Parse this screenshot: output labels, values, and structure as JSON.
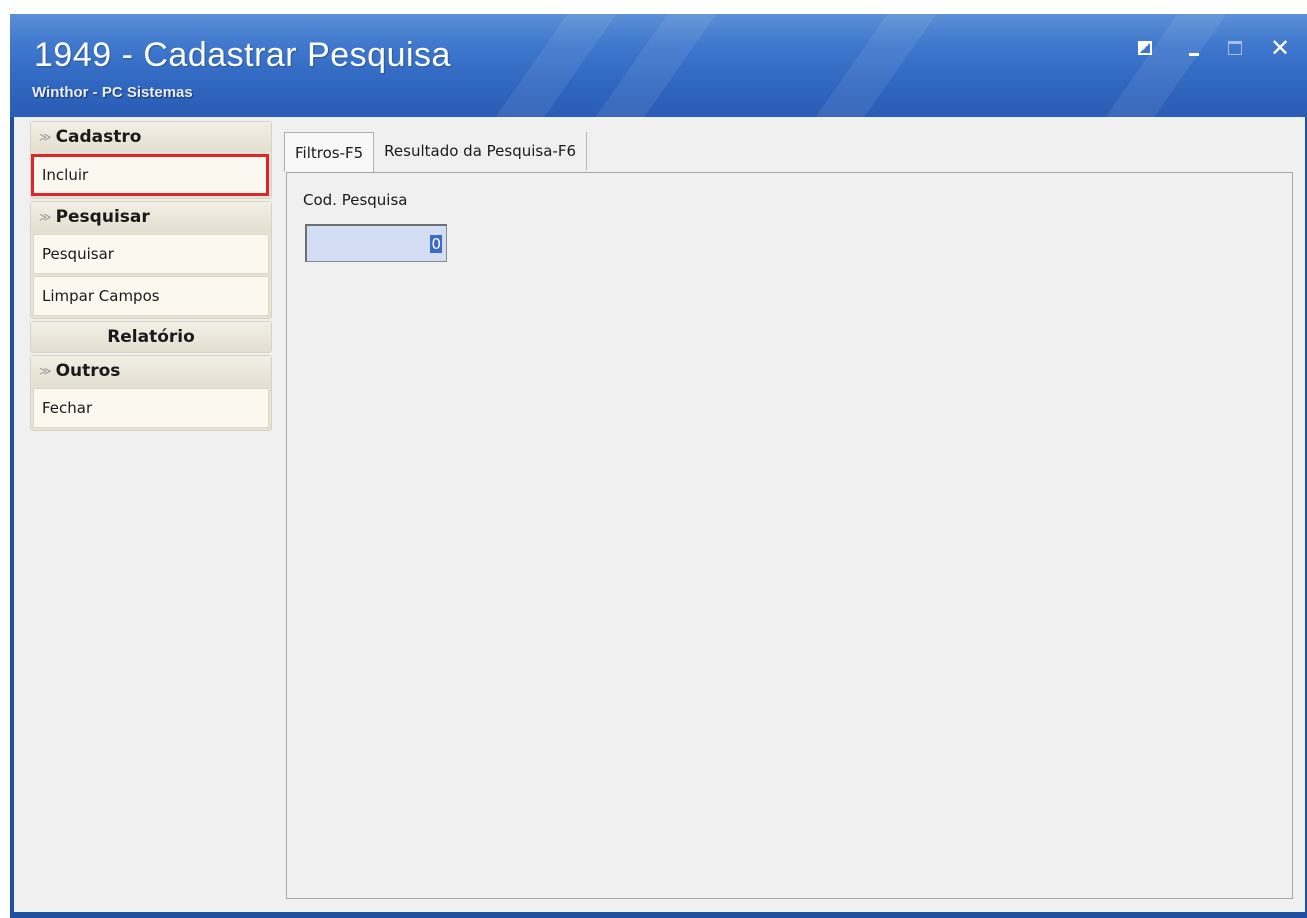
{
  "window": {
    "title": "1949 - Cadastrar Pesquisa",
    "subtitle": "Winthor - PC Sistemas",
    "controls": {
      "restore_icon": "restore-icon",
      "minimize_icon": "minimize-icon",
      "maximize_icon": "maximize-icon",
      "close_icon": "close-icon",
      "close_glyph": "✕"
    }
  },
  "sidebar": {
    "groups": [
      {
        "header": "Cadastro",
        "items": [
          "Incluir"
        ]
      },
      {
        "header": "Pesquisar",
        "items": [
          "Pesquisar",
          "Limpar Campos"
        ]
      },
      {
        "header": "Relatório",
        "items": []
      },
      {
        "header": "Outros",
        "items": [
          "Fechar"
        ]
      }
    ],
    "chevron_glyph": "≫"
  },
  "tabs": [
    {
      "label": "Filtros-F5",
      "active": true
    },
    {
      "label": "Resultado da Pesquisa-F6",
      "active": false
    }
  ],
  "form": {
    "cod_pesquisa_label": "Cod. Pesquisa",
    "cod_pesquisa_value": "0"
  },
  "colors": {
    "titlebar": "#2f66bf",
    "highlight": "#e0242b",
    "input_bg": "#d3def5"
  }
}
